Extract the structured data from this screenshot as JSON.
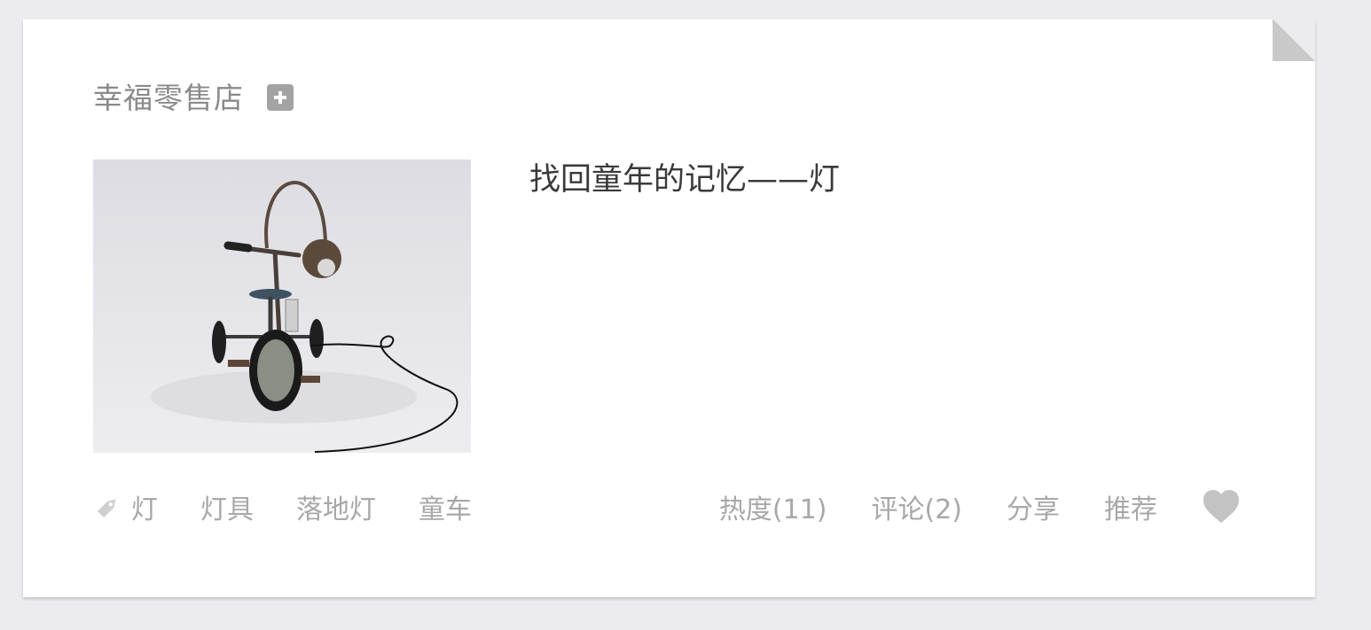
{
  "blog": {
    "name": "幸福零售店"
  },
  "post": {
    "title": "找回童年的记忆——灯"
  },
  "tags": [
    "灯",
    "灯具",
    "落地灯",
    "童车"
  ],
  "actions": {
    "hot": "热度(11)",
    "comment": "评论(2)",
    "share": "分享",
    "recommend": "推荐"
  },
  "icons": {
    "follow": "plus-icon",
    "tag": "tag-icon",
    "like": "heart-icon"
  },
  "colors": {
    "background": "#ececee",
    "card": "#ffffff",
    "muted_text": "#a8a8a8",
    "title_text": "#3a3a3a"
  }
}
